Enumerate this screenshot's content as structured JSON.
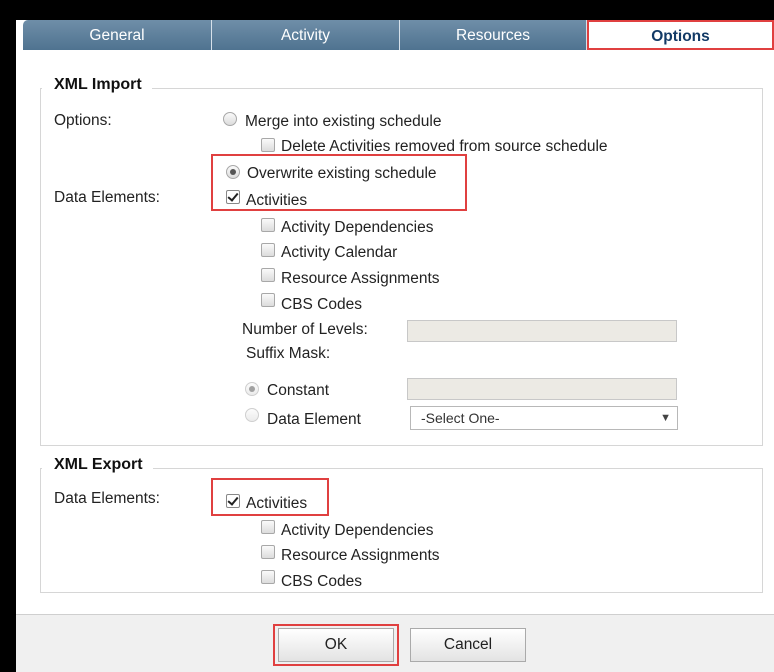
{
  "tabs": [
    {
      "label": "General"
    },
    {
      "label": "Activity"
    },
    {
      "label": "Resources"
    },
    {
      "label": "Options"
    }
  ],
  "xml_import": {
    "legend": "XML Import",
    "options_label": "Options:",
    "data_elements_label": "Data Elements:",
    "merge_label": "Merge into existing schedule",
    "delete_label": "Delete Activities removed from source schedule",
    "overwrite_label": "Overwrite existing schedule",
    "activities_label": "Activities",
    "sub_items": [
      {
        "label": "Activity Dependencies"
      },
      {
        "label": "Activity Calendar"
      },
      {
        "label": "Resource Assignments"
      },
      {
        "label": "CBS Codes"
      }
    ],
    "levels_label": "Number of Levels:",
    "suffix_label": "Suffix Mask:",
    "constant_label": "Constant",
    "data_element_label": "Data Element",
    "select_value": "-Select One-"
  },
  "xml_export": {
    "legend": "XML Export",
    "data_elements_label": "Data Elements:",
    "activities_label": "Activities",
    "sub_items": [
      {
        "label": "Activity Dependencies"
      },
      {
        "label": "Resource Assignments"
      },
      {
        "label": "CBS Codes"
      }
    ]
  },
  "buttons": {
    "ok_label": "OK",
    "cancel_label": "Cancel"
  },
  "highlight_color": "#e04040",
  "tab_color": "#4f7390"
}
